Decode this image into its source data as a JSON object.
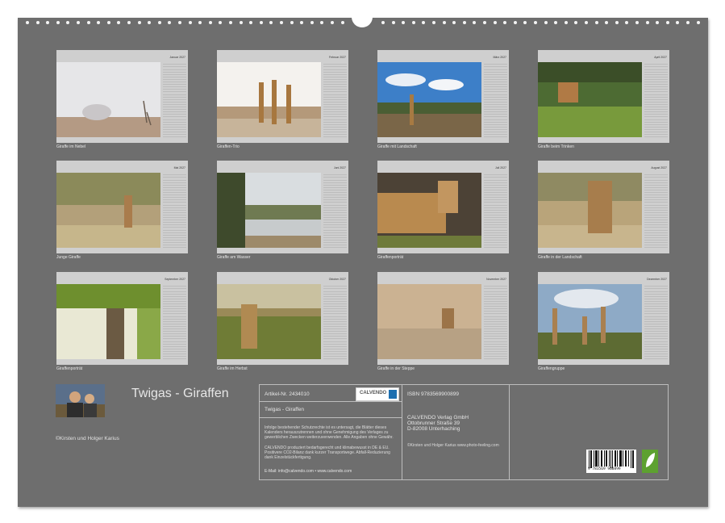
{
  "months": [
    {
      "month": "Januar 2027",
      "caption": "Giraffe im Nebel"
    },
    {
      "month": "Februar 2027",
      "caption": "Giraffen-Trio"
    },
    {
      "month": "März 2027",
      "caption": "Giraffe mit Landschaft"
    },
    {
      "month": "April 2027",
      "caption": "Giraffe beim Trinken"
    },
    {
      "month": "Mai 2027",
      "caption": "Junge Giraffe"
    },
    {
      "month": "Juni 2027",
      "caption": "Giraffe am Wasser"
    },
    {
      "month": "Juli 2027",
      "caption": "Giraffenporträt"
    },
    {
      "month": "August 2027",
      "caption": "Giraffe in der Landschaft"
    },
    {
      "month": "September 2027",
      "caption": "Giraffenporträt"
    },
    {
      "month": "Oktober 2027",
      "caption": "Giraffe im Herbst"
    },
    {
      "month": "November 2027",
      "caption": "Giraffe in der Steppe"
    },
    {
      "month": "Dezember 2027",
      "caption": "Giraffengruppe"
    }
  ],
  "cover": {
    "title": "Twigas - Giraffen",
    "authors": "©Kirsten und Holger Karius"
  },
  "info": {
    "article": "Artikel-Nr. 2434010",
    "product_title": "Twigas - Giraffen",
    "logo": "CALVENDO",
    "legal_1": "Infolge bestehender Schutzrechte ist es untersagt, die Blätter dieses Kalenders herauszutrennen und ohne Genehmigung des Verlages zu gewerblichen Zwecken weiterzuverwenden. Alle Angaben ohne Gewähr.",
    "legal_2": "CALVENDO produziert bedarfsgerecht und klimabewusst in DE & EU. Positivere CO2-Bilanz dank kurzer Transportwege. Abfall-Reduzierung dank Einzelstückfertigung.",
    "email": "E-Mail: info@calvendo.com • www.calvendo.com",
    "isbn": "ISBN 9783569900899",
    "publisher": [
      "CALVENDO Verlag GmbH",
      "Ottobrunner Straße 39",
      "D-82008 Unterhaching"
    ],
    "credit": "©Kirsten und Holger Karius www.photo-feeling.com",
    "barcode_number": "9 783569 900899"
  }
}
